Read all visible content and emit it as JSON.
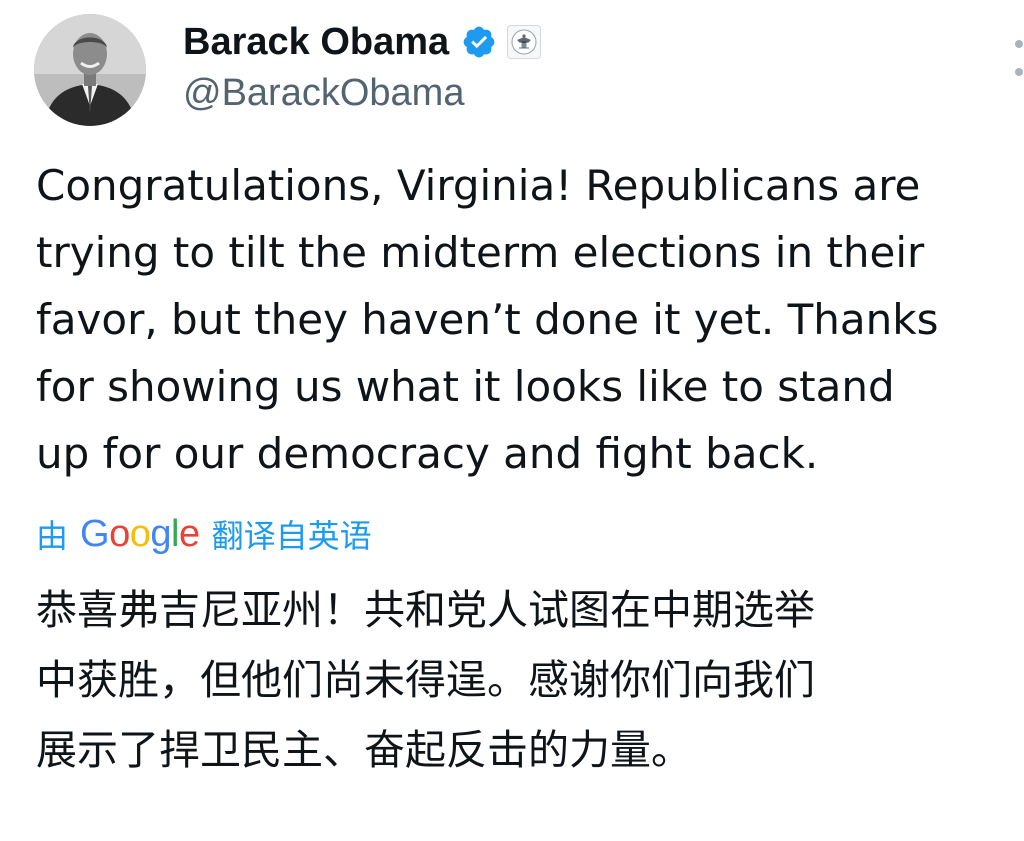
{
  "author": {
    "display_name": "Barack Obama",
    "handle": "@BarackObama",
    "avatar": "profile-photo",
    "verified_icon": "verified-checkmark-icon",
    "affiliation_icon": "government-seal-icon"
  },
  "tweet": {
    "lines": [
      "Congratulations, Virginia! Republicans are",
      "trying to tilt the midterm elections in their",
      "favor, but they haven’t done it yet. Thanks",
      "for showing us what it looks like to stand",
      "up for our democracy and fight back."
    ]
  },
  "translation": {
    "prefix": "由",
    "provider": "Google",
    "suffix": "翻译自英语",
    "lines": [
      "恭喜弗吉尼亚州！共和党人试图在中期选举",
      "中获胜，但他们尚未得逞。感谢你们向我们",
      "展示了捍卫民主、奋起反击的力量。"
    ]
  },
  "colors": {
    "verified_blue": "#1d9bf0",
    "handle_gray": "#536471",
    "text": "#0f1419",
    "google_blue": "#4285f4",
    "google_red": "#ea4335",
    "google_yellow": "#fbbc05",
    "google_green": "#34a853"
  }
}
